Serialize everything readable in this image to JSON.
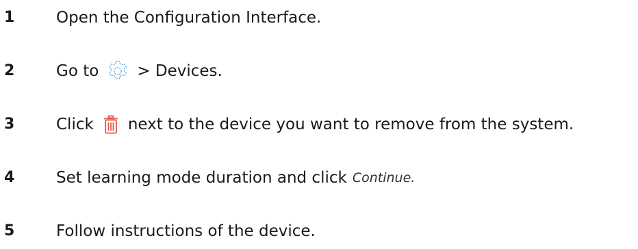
{
  "steps": [
    {
      "number": "1",
      "text": "Open the Configuration Interface."
    },
    {
      "number": "2",
      "before": "Go to",
      "after": "> Devices.",
      "icon": "gear-icon"
    },
    {
      "number": "3",
      "before": "Click",
      "after": "next to the device you want to remove from the system.",
      "icon": "trash-icon"
    },
    {
      "number": "4",
      "before": "Set learning mode duration and click",
      "emphasis": "Continue."
    },
    {
      "number": "5",
      "text": "Follow instructions of the device."
    }
  ],
  "colors": {
    "gear_icon": "#5aa3d6",
    "trash_icon": "#e2574c",
    "text": "#1a1a1a"
  }
}
